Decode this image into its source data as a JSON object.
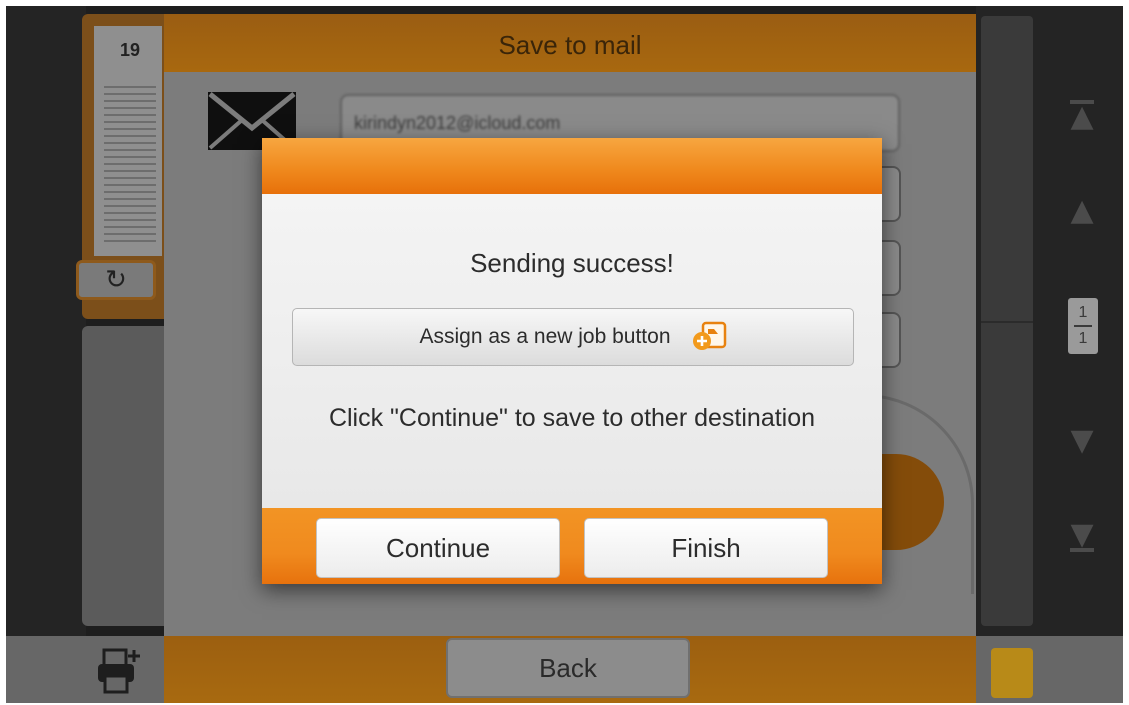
{
  "mail_dialog": {
    "title": "Save to mail",
    "email_value": "kirindyn2012@icloud.com",
    "back_label": "Back"
  },
  "thumbnail": {
    "page_number": "19"
  },
  "pager": {
    "current": "1",
    "total": "1"
  },
  "popup": {
    "message": "Sending success!",
    "assign_label": "Assign as a new job button",
    "info": "Click \"Continue\" to save to other destination",
    "continue_label": "Continue",
    "finish_label": "Finish"
  },
  "icons": {
    "mail": "envelope-icon",
    "rotate": "rotate-icon",
    "printer": "printer-add-icon",
    "assign": "add-job-icon",
    "nav": [
      "first-page-icon",
      "prev-page-icon",
      "next-page-icon",
      "last-page-icon"
    ]
  },
  "colors": {
    "accent_orange": "#f08a1e",
    "popup_body": "#eeeeee",
    "dim_background": "#1e1e1e"
  }
}
